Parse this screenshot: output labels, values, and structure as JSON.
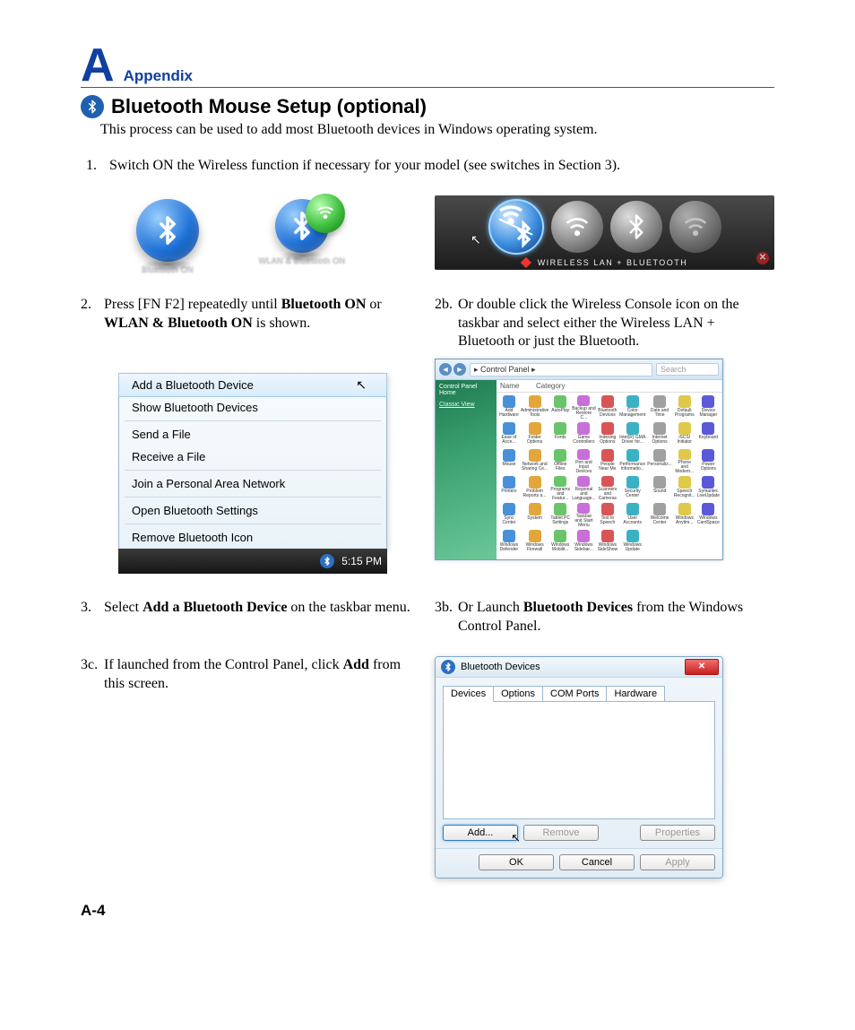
{
  "header": {
    "letter": "A",
    "label": "Appendix"
  },
  "section": {
    "title": "Bluetooth Mouse Setup (optional)",
    "intro": "This process can be used to add most Bluetooth devices in Windows operating system."
  },
  "steps": {
    "s1_num": "1.",
    "s1": "Switch ON the Wireless function if necessary for your model (see switches in Section 3).",
    "s2_num": "2.",
    "s2_pre": "Press [FN F2] repeatedly until ",
    "s2_bold1": "Bluetooth ON",
    "s2_mid": " or ",
    "s2_bold2": "WLAN & Bluetooth ON",
    "s2_post": " is shown.",
    "s2b_num": "2b.",
    "s2b": "Or double click the Wireless Console icon on the taskbar and select either the Wireless LAN + Bluetooth or just the Bluetooth.",
    "s3_num": "3.",
    "s3_pre": "Select ",
    "s3_bold": "Add a Bluetooth Device",
    "s3_post": " on the taskbar menu.",
    "s3b_num": "3b.",
    "s3b_pre": "Or Launch ",
    "s3b_bold": "Bluetooth Devices",
    "s3b_post": " from the Windows Control Panel.",
    "s3c_num": "3c.",
    "s3c_pre": "If launched from the Control Panel, click ",
    "s3c_bold": "Add",
    "s3c_post": " from this screen."
  },
  "bt_status": {
    "label_bt": "Bluetooth ON",
    "label_both": "WLAN & Bluetooth ON"
  },
  "console": {
    "label": "WIRELESS LAN + BLUETOOTH"
  },
  "context_menu": {
    "add": "Add a Bluetooth Device",
    "show": "Show Bluetooth Devices",
    "send": "Send a File",
    "receive": "Receive a File",
    "pan": "Join a Personal Area Network",
    "settings": "Open Bluetooth Settings",
    "remove": "Remove Bluetooth Icon",
    "clock": "5:15 PM"
  },
  "control_panel": {
    "path": "Control Panel",
    "search": "Search",
    "sidebar_home": "Control Panel Home",
    "sidebar_classic": "Classic View",
    "headers": {
      "name": "Name",
      "cat": "Category"
    },
    "items": [
      "Add Hardware",
      "Administrative Tools",
      "AutoPlay",
      "Backup and Restore C...",
      "Bluetooth Devices",
      "Color Management",
      "Date and Time",
      "Default Programs",
      "Device Manager",
      "Ease of Acce...",
      "Folder Options",
      "Fonts",
      "Game Controllers",
      "Indexing Options",
      "Intel(R) GMA Driver for...",
      "Internet Options",
      "iSCSI Initiator",
      "Keyboard",
      "Mouse",
      "Network and Sharing Ce...",
      "Offline Files",
      "Pen and Input Devices",
      "People Near Me",
      "Performance Informatio...",
      "Personaliz...",
      "Phone and Modem...",
      "Power Options",
      "Printers",
      "Problem Reports a...",
      "Programs and Featur...",
      "Regional and Language...",
      "Scanners and Cameras",
      "Security Center",
      "Sound",
      "Speech Recognit...",
      "Symantec LiveUpdate",
      "Sync Center",
      "System",
      "Tablet PC Settings",
      "Taskbar and Start Menu",
      "Text to Speech",
      "User Accounts",
      "Welcome Center",
      "Windows Anytim...",
      "Windows CardSpace",
      "Windows Defender",
      "Windows Firewall",
      "Windows Mobilit...",
      "Windows Sidebar...",
      "Windows SideShow",
      "Windows Update"
    ]
  },
  "btd": {
    "title": "Bluetooth Devices",
    "tabs": {
      "devices": "Devices",
      "options": "Options",
      "com": "COM Ports",
      "hardware": "Hardware"
    },
    "buttons": {
      "add": "Add...",
      "remove": "Remove",
      "props": "Properties",
      "ok": "OK",
      "cancel": "Cancel",
      "apply": "Apply"
    }
  },
  "footer": {
    "page": "A-4"
  }
}
